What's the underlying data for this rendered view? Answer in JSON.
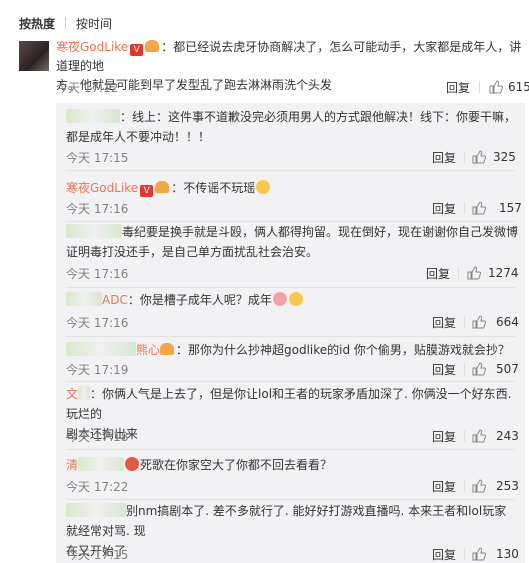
{
  "sort": {
    "hot": "按热度",
    "time": "按时间"
  },
  "main_comment": {
    "username": "寒夜GodLike",
    "vip_mark": "V",
    "text_line1": "：都已经说去虎牙协商解决了，怎么可能动手，大家都是成年人，讲道理的地",
    "text_line2": "方。他就是可能到早了发型乱了跑去淋淋雨洗个头发",
    "time": "今天 17:12",
    "reply_label": "回复",
    "likes": "615"
  },
  "replies": [
    {
      "name": "",
      "text": "：线上：这件事不道歉没完必须用男人的方式跟他解决！线下：你要干嘛，都是成年人不要冲动！！！",
      "time": "今天 17:15",
      "reply_label": "回复",
      "likes": "325"
    },
    {
      "name": "寒夜GodLike",
      "vip_mark": "V",
      "text": "：不传谣不玩瑶",
      "time": "今天 17:16",
      "reply_label": "回复",
      "likes": "157"
    },
    {
      "name": "",
      "text_line1": "毒纪要是换手就是斗殴，俩人都得拘留。现在倒好，现在谢谢你自己发微博",
      "text_line2": "证明毒打没还手，是自己单方面扰乱社会治安。",
      "time": "今天 17:16",
      "reply_label": "回复",
      "likes": "1274"
    },
    {
      "name": "ADC",
      "text": "：你是槽子成年人呢？成年",
      "time": "今天 17:16",
      "reply_label": "回复",
      "likes": "664"
    },
    {
      "name": "熊心",
      "text": "：那你为什么抄神超godlike的id 你个偷男，贴膜游戏就会抄？",
      "time": "今天 17:19",
      "reply_label": "回复",
      "likes": "507"
    },
    {
      "name": "文",
      "text_line1": "：你俩人气是上去了，但是你让lol和王者的玩家矛盾加深了. 你俩没一个好东西. 玩烂的",
      "text_line2": "剧本还掏出来",
      "time": "今天 17:18",
      "reply_label": "回复",
      "likes": "243"
    },
    {
      "name": "清",
      "text": "死歌在你家空大了你都不回去看看？",
      "time": "今天 17:22",
      "reply_label": "回复",
      "likes": "253"
    },
    {
      "name": "",
      "text_line1": "别nm搞剧本了. 差不多就行了. 能好好打游戏直播吗. 本来王者和lol玩家就经常对骂. 现",
      "text_line2": "在又开始了",
      "time": "今天 17:15",
      "reply_label": "回复",
      "likes": "130"
    }
  ],
  "icons": {
    "thumb": "thumbs-up-icon"
  },
  "colors": {
    "username": "#eb7350",
    "vip": "#e5352c",
    "reply_bg": "#f2f2f5"
  }
}
